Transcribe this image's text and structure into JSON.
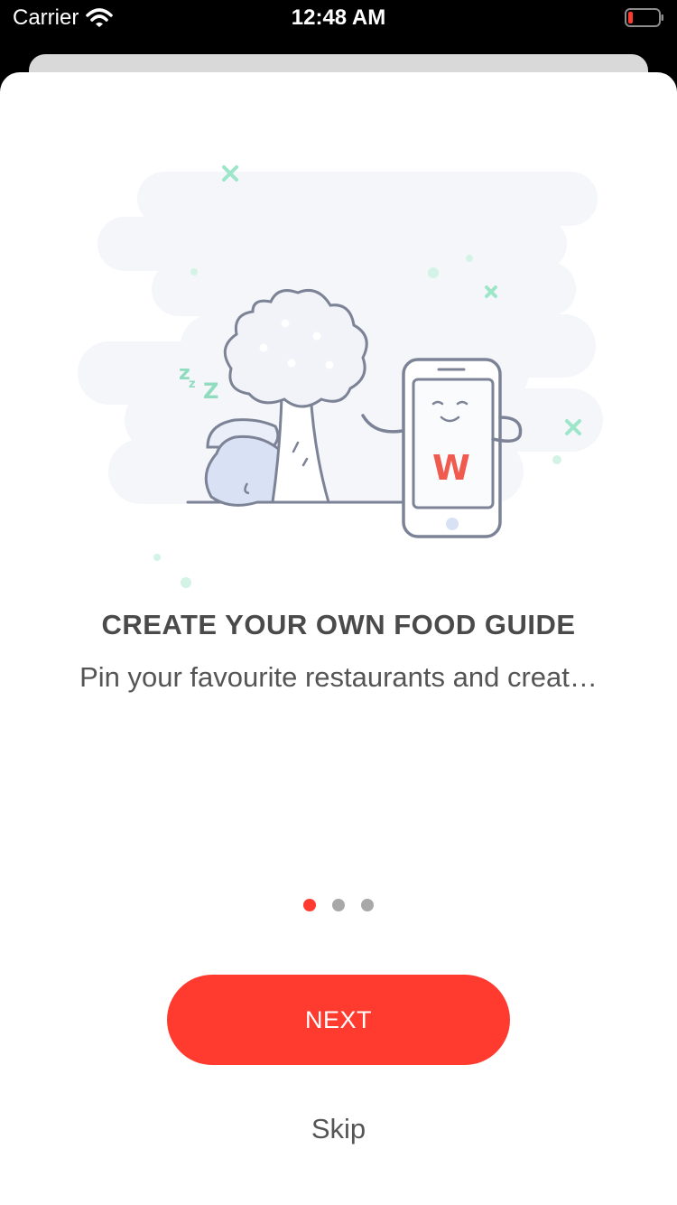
{
  "status_bar": {
    "carrier": "Carrier",
    "time": "12:48 AM",
    "battery_color": "#ff3b30"
  },
  "onboarding": {
    "illustration": {
      "icon": "sleeping-tree-and-phone-illustration",
      "phone_logo": "W",
      "sleep_text": "zzZ",
      "accent_color": "#9ee6c9",
      "logo_color": "#f05a4f"
    },
    "title": "CREATE YOUR OWN FOOD GUIDE",
    "subtitle": "Pin your favourite restaurants and creat…",
    "page_indicator": {
      "total": 3,
      "current": 1,
      "active_color": "#ff3b30",
      "inactive_color": "#a8a8a8"
    },
    "next_label": "NEXT",
    "skip_label": "Skip"
  }
}
